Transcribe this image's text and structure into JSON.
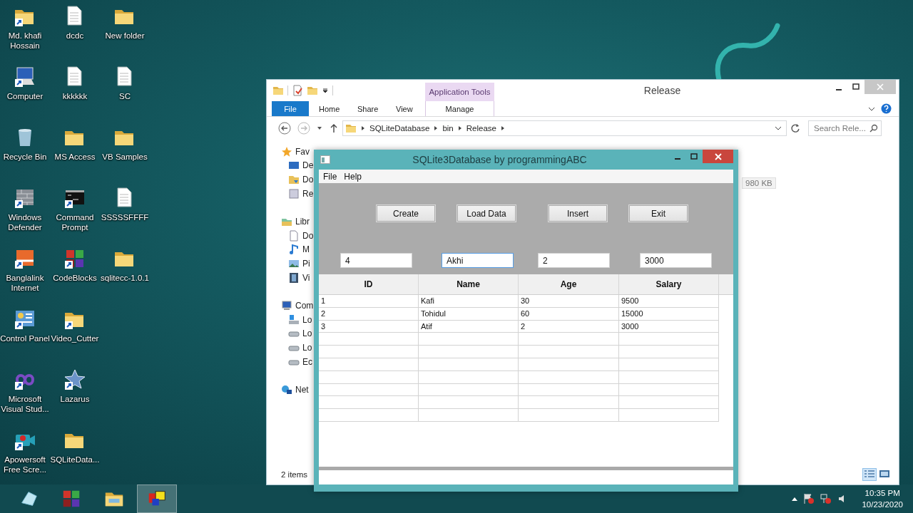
{
  "desktop": {
    "icons": [
      {
        "label": "Md. khafi Hossain",
        "kind": "folder",
        "shortcut": true
      },
      {
        "label": "Computer",
        "kind": "computer",
        "shortcut": true
      },
      {
        "label": "Recycle Bin",
        "kind": "recycle-bin",
        "shortcut": false
      },
      {
        "label": "Windows Defender",
        "kind": "wall",
        "shortcut": true
      },
      {
        "label": "Banglalink Internet",
        "kind": "orange",
        "shortcut": true
      },
      {
        "label": "Control Panel",
        "kind": "control-panel",
        "shortcut": true
      },
      {
        "label": "Microsoft Visual Stud...",
        "kind": "infinity",
        "shortcut": true
      },
      {
        "label": "Apowersoft Free Scre...",
        "kind": "camera",
        "shortcut": true
      },
      {
        "label": "dcdc",
        "kind": "document",
        "shortcut": false
      },
      {
        "label": "kkkkkk",
        "kind": "document",
        "shortcut": false
      },
      {
        "label": "MS Access",
        "kind": "folder",
        "shortcut": false
      },
      {
        "label": "Command Prompt",
        "kind": "console",
        "shortcut": true
      },
      {
        "label": "CodeBlocks",
        "kind": "tiles",
        "shortcut": true
      },
      {
        "label": "Video_Cutter",
        "kind": "folder",
        "shortcut": true
      },
      {
        "label": "Lazarus",
        "kind": "star",
        "shortcut": true
      },
      {
        "label": "SQLiteData...",
        "kind": "folder",
        "shortcut": false
      },
      {
        "label": "New folder",
        "kind": "folder",
        "shortcut": false
      },
      {
        "label": "SC",
        "kind": "document",
        "shortcut": false
      },
      {
        "label": "VB Samples",
        "kind": "folder",
        "shortcut": false
      },
      {
        "label": "SSSSSFFFF",
        "kind": "document",
        "shortcut": false
      },
      {
        "label": "sqlitecc-1.0.1",
        "kind": "folder",
        "shortcut": false
      }
    ]
  },
  "explorer": {
    "title": "Release",
    "context_tab": "Application Tools",
    "ribbon_tabs": [
      {
        "label": "File",
        "kind": "file"
      },
      {
        "label": "Home",
        "kind": "tab"
      },
      {
        "label": "Share",
        "kind": "tab"
      },
      {
        "label": "View",
        "kind": "tab"
      },
      {
        "label": "Manage",
        "kind": "context"
      }
    ],
    "breadcrumb": [
      "SQLiteDatabase",
      "bin",
      "Release"
    ],
    "search": {
      "placeholder": "Search Rele..."
    },
    "nav_groups": [
      {
        "label": "Fav",
        "kind": "star",
        "children": [
          {
            "label": "De",
            "kind": "desktop"
          },
          {
            "label": "Do",
            "kind": "folder"
          },
          {
            "label": "Re",
            "kind": "recent"
          }
        ]
      },
      {
        "label": "Libr",
        "kind": "library",
        "children": [
          {
            "label": "Do",
            "kind": "document"
          },
          {
            "label": "M",
            "kind": "music"
          },
          {
            "label": "Pi",
            "kind": "picture"
          },
          {
            "label": "Vi",
            "kind": "video"
          }
        ]
      },
      {
        "label": "Com",
        "kind": "computer",
        "children": [
          {
            "label": "Lo",
            "kind": "system-drive"
          },
          {
            "label": "Lo",
            "kind": "drive"
          },
          {
            "label": "Lo",
            "kind": "drive"
          },
          {
            "label": "Ec",
            "kind": "drive"
          }
        ]
      },
      {
        "label": "Net",
        "kind": "network"
      }
    ],
    "file_size": "980 KB",
    "status": "2 items"
  },
  "app": {
    "title": "SQLite3Database by programmingABC",
    "menu": [
      "File",
      "Help"
    ],
    "buttons": [
      "Create",
      "Load Data",
      "Insert",
      "Exit"
    ],
    "fields": [
      {
        "value": "4",
        "focused": false
      },
      {
        "value": "Akhi",
        "focused": true
      },
      {
        "value": "2",
        "focused": false
      },
      {
        "value": "3000",
        "focused": false
      }
    ],
    "table": {
      "columns": [
        "ID",
        "Name",
        "Age",
        "Salary"
      ],
      "rows": [
        [
          "1",
          "Kafi",
          "30",
          "9500"
        ],
        [
          "2",
          "Tohidul",
          "60",
          "15000"
        ],
        [
          "3",
          "Atif",
          "2",
          "3000"
        ]
      ]
    }
  },
  "taskbar": {
    "buttons": [
      {
        "kind": "cube",
        "selected": false
      },
      {
        "kind": "tiles",
        "selected": false
      },
      {
        "kind": "folder",
        "selected": false
      },
      {
        "kind": "blocks",
        "selected": true
      }
    ],
    "clock": {
      "time": "10:35 PM",
      "date": "10/23/2020"
    }
  }
}
